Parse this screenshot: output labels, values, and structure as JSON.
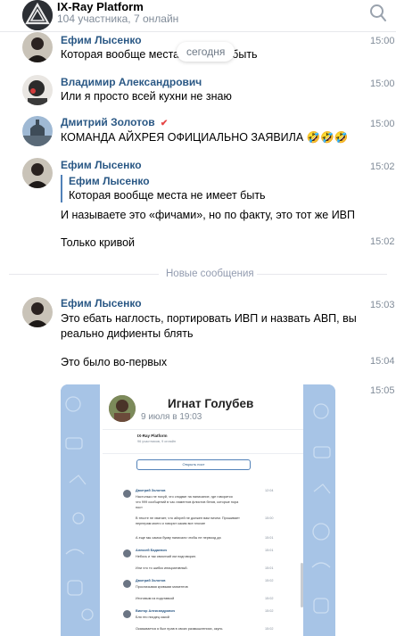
{
  "header": {
    "title": "IX-Ray Platform",
    "subtitle": "104 участника, 7 онлайн"
  },
  "date_pill": "сегодня",
  "messages": [
    {
      "author": "Ефим Лысенко",
      "time": "15:00",
      "text": "Которая вообще места не имеет быть"
    },
    {
      "author": "Владимир Александрович",
      "time": "15:00",
      "text": "Или я просто всей кухни не знаю"
    },
    {
      "author": "Дмитрий Золотов",
      "author_badge": "✔",
      "time": "15:00",
      "text": "КОМАНДА АЙХРЕЯ ОФИЦИАЛЬНО ЗАЯВИЛА 🤣🤣🤣"
    },
    {
      "author": "Ефим Лысенко",
      "time": "15:02",
      "reply": {
        "author": "Ефим Лысенко",
        "text": "Которая вообще места не имеет быть"
      },
      "text": "И называете это «фичами», но по факту, это тот же ИВП",
      "followups": [
        {
          "text": "Только кривой",
          "time": "15:02"
        }
      ]
    },
    {
      "author": "Ефим Лысенко",
      "time": "15:03",
      "text_lines": [
        "Это ебать наглость, портировать ИВП и назвать АВП, вы",
        "реально дифиенты блять"
      ],
      "followups": [
        {
          "text": "Это было во-первых",
          "time": "15:04"
        }
      ],
      "attachment_time": "15:05"
    }
  ],
  "new_messages_divider": "Новые сообщения",
  "attachment": {
    "title": "Игнат Голубев",
    "date": "9 июля в 19:03",
    "inner_chat_title": "IX-Ray Platform",
    "inner_chat_sub": "96 участников, 9 онлайн",
    "button": "Открыть пост",
    "rows": [
      {
        "name": "Дмитрий Золотов",
        "time": "12:04",
        "lines": [
          "Настолько не похуй, что сподвиг на написание, где говорится",
          "что 999 сообщений в час ламентов флиcтов бегов, которые пора",
          "пост"
        ]
      },
      {
        "line": "В тексте не хватает, что айхрей не должен вам ничем. Прошивает",
        "time": "15:00"
      },
      {
        "line": "пернерам моего и говорят каким все плохие"
      },
      {
        "line": "А еще мы самоа букву написали чтобы не первоод да",
        "time": "15:01"
      },
      {
        "name": "Алексей Бадаевич",
        "time": "15:01",
        "lines": [
          "Небось и так свиолчий им подговорил."
        ]
      },
      {
        "line": "Или что то шибко инициативный.",
        "time": "15:01"
      },
      {
        "name": "Дмитрий Золотов",
        "time": "15:02",
        "lines": [
          "Прослизывая кривыми моментов"
        ]
      },
      {
        "line": "Итоговым из подставкой",
        "time": "15:02"
      },
      {
        "name": "Виктор Александрович",
        "time": "15:02",
        "lines": [
          "Бля это писдец какой"
        ]
      },
      {
        "line": "Оказывается я был прав в своих размышлениях, окунь",
        "time": "15:02"
      }
    ]
  }
}
